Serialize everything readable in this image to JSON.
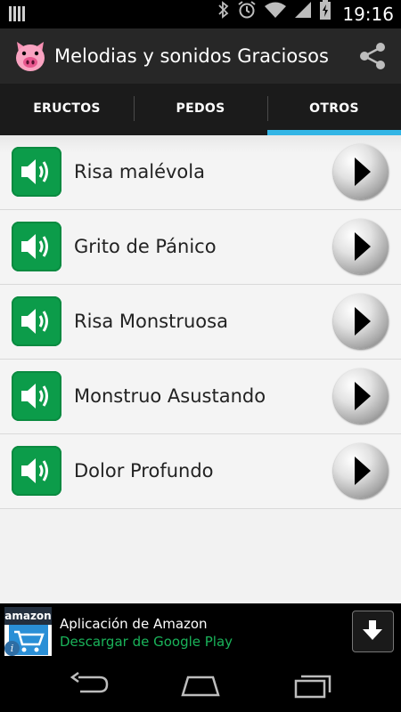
{
  "status_bar": {
    "time": "19:16",
    "icons": [
      "signal-bars-icon",
      "bluetooth-icon",
      "alarm-icon",
      "wifi-icon",
      "cell-signal-icon",
      "battery-charging-icon"
    ]
  },
  "action_bar": {
    "title": "Melodias y sonidos Graciosos",
    "app_icon": "pig-face-icon",
    "share_icon": "share-icon"
  },
  "tabs": [
    {
      "label": "ERUCTOS",
      "active": false
    },
    {
      "label": "PEDOS",
      "active": false
    },
    {
      "label": "OTROS",
      "active": true
    }
  ],
  "sounds": [
    {
      "label": "Risa malévola"
    },
    {
      "label": "Grito de Pánico"
    },
    {
      "label": "Risa Monstruosa"
    },
    {
      "label": "Monstruo Asustando"
    },
    {
      "label": "Dolor Profundo"
    }
  ],
  "ad": {
    "brand": "amazon",
    "title": "Aplicación de Amazon",
    "subtitle": "Descargar de Google Play",
    "info_badge": "i"
  },
  "colors": {
    "accent": "#33b5e5",
    "speaker_green": "#0c9c4a",
    "ad_green": "#1ab35a",
    "action_bar": "#272727"
  }
}
